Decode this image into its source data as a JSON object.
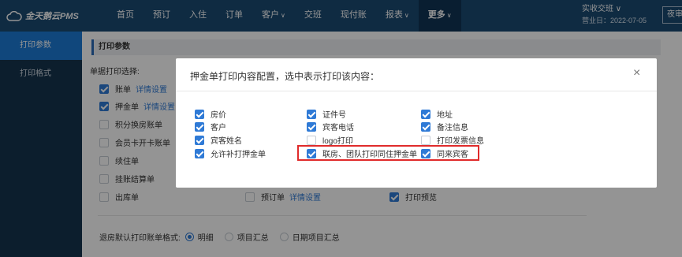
{
  "app": {
    "logo_text": "金天鹅云PMS"
  },
  "nav": {
    "items": [
      {
        "label": "首页",
        "dropdown": false,
        "active": false
      },
      {
        "label": "预订",
        "dropdown": false,
        "active": false
      },
      {
        "label": "入住",
        "dropdown": false,
        "active": false
      },
      {
        "label": "订单",
        "dropdown": false,
        "active": false
      },
      {
        "label": "客户",
        "dropdown": true,
        "active": false
      },
      {
        "label": "交班",
        "dropdown": false,
        "active": false
      },
      {
        "label": "现付账",
        "dropdown": false,
        "active": false
      },
      {
        "label": "报表",
        "dropdown": true,
        "active": false
      },
      {
        "label": "更多",
        "dropdown": true,
        "active": true
      }
    ],
    "caret": "∨"
  },
  "header_right": {
    "shift_label": "实收交班 ∨",
    "business_date": "营业日：2022-07-05",
    "exit_label": "夜审"
  },
  "sidebar": {
    "items": [
      {
        "label": "打印参数",
        "active": true
      },
      {
        "label": "打印格式",
        "active": false
      }
    ]
  },
  "main": {
    "section_title": "打印参数",
    "bill_print_label": "单据打印选择:",
    "options": [
      {
        "label": "账单",
        "checked": true,
        "link": "详情设置"
      },
      {
        "label": "押金单",
        "checked": true,
        "link": "详情设置"
      },
      {
        "label": "积分换房账单",
        "checked": false,
        "link": ""
      },
      {
        "label": "会员卡开卡账单",
        "checked": false,
        "link": ""
      },
      {
        "label": "续住单",
        "checked": false,
        "link": ""
      },
      {
        "label": "挂账结算单",
        "checked": false,
        "link": ""
      },
      {
        "label": "出库单",
        "checked": false,
        "link": ""
      }
    ],
    "preorder": {
      "label": "预订单",
      "checked": false,
      "link": "详情设置"
    },
    "print_preview": {
      "label": "打印预览",
      "checked": true
    },
    "checkout_format": {
      "label": "退房默认打印账单格式:",
      "choices": [
        {
          "label": "明细",
          "selected": true
        },
        {
          "label": "项目汇总",
          "selected": false
        },
        {
          "label": "日期项目汇总",
          "selected": false
        }
      ]
    }
  },
  "modal": {
    "title": "押金单打印内容配置，选中表示打印该内容：",
    "close_glyph": "×",
    "columns": [
      [
        {
          "label": "房价",
          "checked": true
        },
        {
          "label": "客户",
          "checked": true
        },
        {
          "label": "宾客姓名",
          "checked": true
        },
        {
          "label": "允许补打押金单",
          "checked": true
        }
      ],
      [
        {
          "label": "证件号",
          "checked": true
        },
        {
          "label": "宾客电话",
          "checked": true
        },
        {
          "label": "logo打印",
          "checked": false
        },
        {
          "label": "联房、团队打印同住押金单",
          "checked": true
        }
      ],
      [
        {
          "label": "地址",
          "checked": true
        },
        {
          "label": "备注信息",
          "checked": true
        },
        {
          "label": "打印发票信息",
          "checked": false
        },
        {
          "label": "同来宾客",
          "checked": true
        }
      ]
    ]
  },
  "colors": {
    "topbar": "#1a4a73",
    "sidebar": "#15344f",
    "accent": "#2f7ad6",
    "highlight": "#e02b2b"
  },
  "icons": {
    "logo": "cloud-logo-icon",
    "close": "close-icon",
    "checkbox": "checkmark-icon"
  }
}
